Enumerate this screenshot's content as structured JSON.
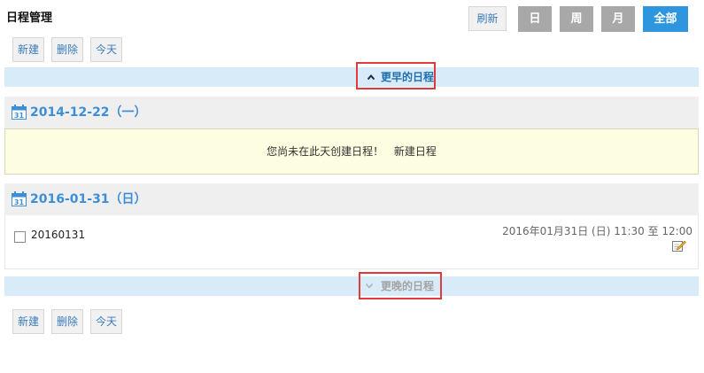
{
  "page": {
    "title": "日程管理"
  },
  "view_switch": {
    "refresh_label": "刷新",
    "day_label": "日",
    "week_label": "周",
    "month_label": "月",
    "all_label": "全部",
    "active_color": "#2e96de",
    "inactive_color": "#a8a8a8"
  },
  "toolbar_top": {
    "new_label": "新建",
    "delete_label": "删除",
    "today_label": "今天"
  },
  "earlier_link": {
    "label": "更早的日程",
    "icon": "chevron-up-icon"
  },
  "days": [
    {
      "date": "2014-12-22（一）",
      "icon": "calendar-31-icon",
      "empty_message": "您尚未在此天创建日程！",
      "create_link": "新建日程"
    },
    {
      "date": "2016-01-31（日）",
      "icon": "calendar-31-icon",
      "events": [
        {
          "title": "20160131",
          "time": "2016年01月31日 (日) 11:30 至 12:00",
          "edit_icon": "edit-icon"
        }
      ]
    }
  ],
  "later_link": {
    "label": "更晚的日程",
    "icon": "chevron-down-icon"
  },
  "toolbar_bottom": {
    "new_label": "新建",
    "delete_label": "删除",
    "today_label": "今天"
  },
  "highlight_color": "#e03a3a"
}
